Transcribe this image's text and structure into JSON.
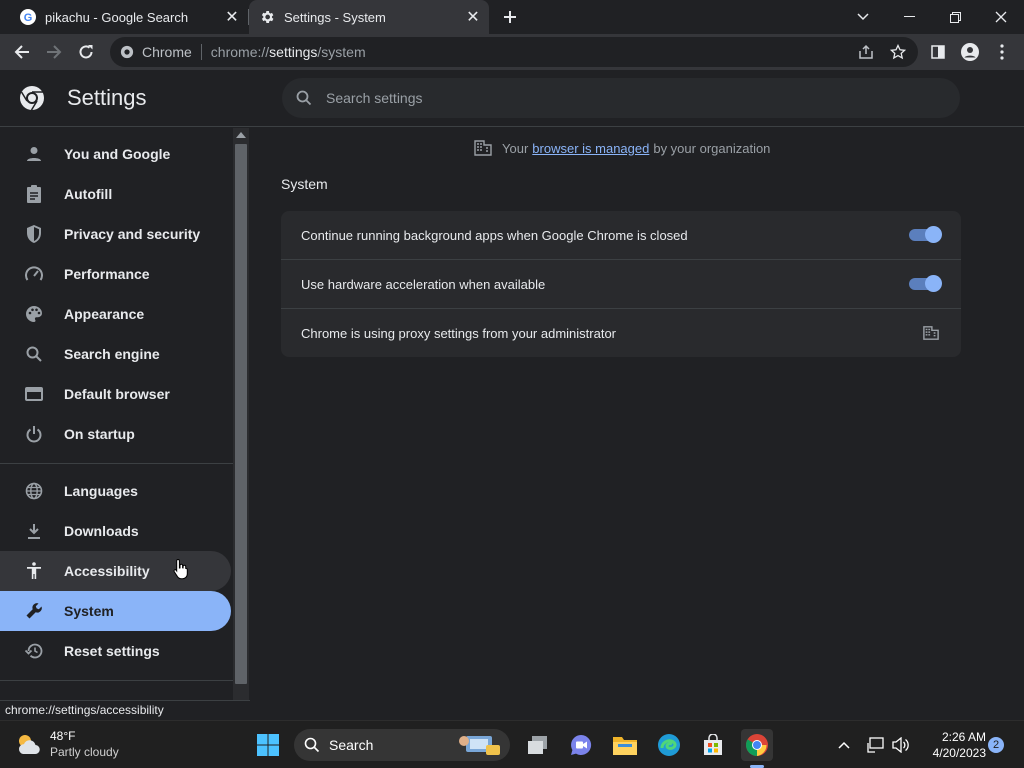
{
  "tabs": [
    {
      "title": "pikachu - Google Search",
      "icon": "google-g-icon",
      "active": false
    },
    {
      "title": "Settings - System",
      "icon": "gear-icon",
      "active": true
    }
  ],
  "toolbar": {
    "site_label": "Chrome",
    "url_prefix": "chrome://",
    "url_host": "settings",
    "url_path": "/system"
  },
  "header": {
    "title": "Settings",
    "search_placeholder": "Search settings"
  },
  "sidebar": {
    "items": [
      {
        "label": "You and Google",
        "icon": "person-icon"
      },
      {
        "label": "Autofill",
        "icon": "clipboard-icon"
      },
      {
        "label": "Privacy and security",
        "icon": "shield-icon"
      },
      {
        "label": "Performance",
        "icon": "speedometer-icon"
      },
      {
        "label": "Appearance",
        "icon": "palette-icon"
      },
      {
        "label": "Search engine",
        "icon": "search-icon"
      },
      {
        "label": "Default browser",
        "icon": "browser-window-icon"
      },
      {
        "label": "On startup",
        "icon": "power-icon"
      },
      {
        "label": "Languages",
        "icon": "globe-icon"
      },
      {
        "label": "Downloads",
        "icon": "download-icon"
      },
      {
        "label": "Accessibility",
        "icon": "accessibility-icon"
      },
      {
        "label": "System",
        "icon": "wrench-icon"
      },
      {
        "label": "Reset settings",
        "icon": "history-icon"
      }
    ],
    "selected": "System",
    "hovered": "Accessibility"
  },
  "status_url": "chrome://settings/accessibility",
  "managed": {
    "prefix": "Your",
    "link": "browser is managed",
    "suffix": "by your organization"
  },
  "section": {
    "title": "System",
    "rows": [
      {
        "label": "Continue running background apps when Google Chrome is closed",
        "control": "toggle",
        "on": true
      },
      {
        "label": "Use hardware acceleration when available",
        "control": "toggle",
        "on": true
      },
      {
        "label": "Chrome is using proxy settings from your administrator",
        "control": "building-icon"
      }
    ]
  },
  "taskbar": {
    "weather_temp": "48°F",
    "weather_cond": "Partly cloudy",
    "search_label": "Search",
    "time": "2:26 AM",
    "date": "4/20/2023",
    "notifications": "2"
  },
  "colors": {
    "accent": "#8ab4f8",
    "background": "#202124",
    "card": "#292a2d"
  }
}
